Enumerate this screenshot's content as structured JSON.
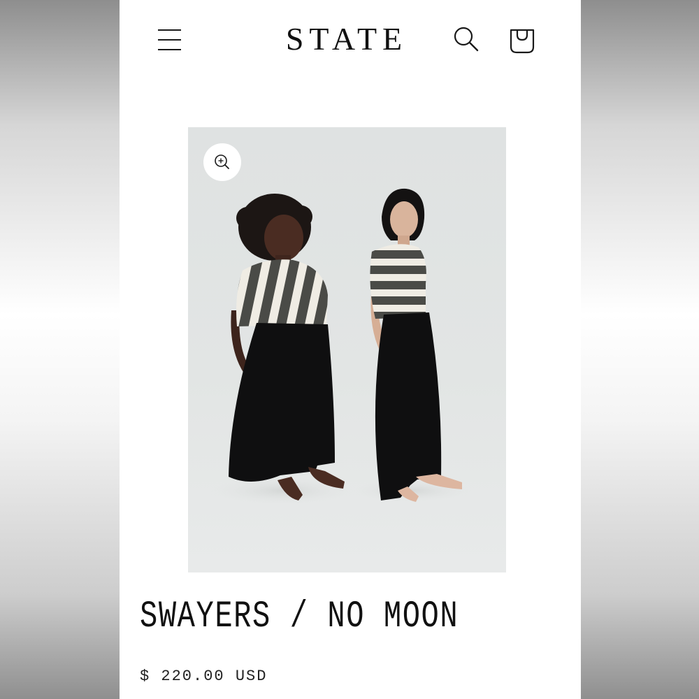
{
  "header": {
    "logo": "STATE",
    "menu_icon": "hamburger-menu-icon",
    "search_icon": "search-icon",
    "cart_icon": "shopping-bag-icon"
  },
  "product": {
    "image_zoom_icon": "zoom-in-icon",
    "title": "SWAYERS / NO MOON",
    "price": "$ 220.00 USD"
  },
  "colors": {
    "text": "#111111",
    "background": "#ffffff",
    "photo_backdrop": "#e2e5e4"
  }
}
